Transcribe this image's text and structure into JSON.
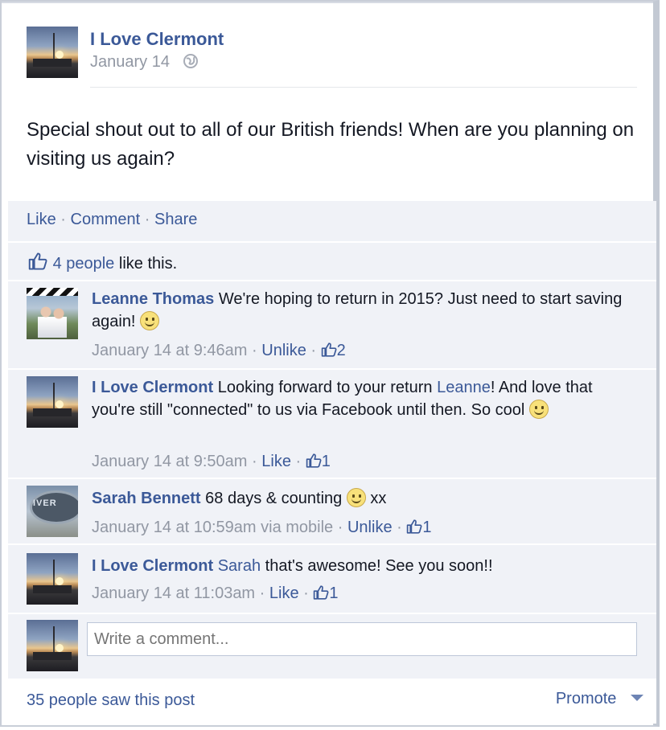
{
  "post": {
    "author": "I Love Clermont",
    "date": "January 14",
    "body": "Special shout out to all of our British friends! When are you planning on visiting us again?"
  },
  "actions": {
    "like": "Like",
    "comment": "Comment",
    "share": "Share",
    "sep": "·"
  },
  "likes": {
    "count_text": "4 people",
    "suffix": "like this."
  },
  "comments": [
    {
      "author": "Leanne Thomas",
      "text": "We're hoping to return in 2015? Just need to start saving again!",
      "timestamp": "January 14 at 9:46am",
      "action": "Unlike",
      "likes": "2"
    },
    {
      "author": "I Love Clermont",
      "text_before": "Looking forward to your return",
      "mention": "Leanne",
      "text_after": "! And love that you're still \"connected\" to us via Facebook until then. So cool",
      "timestamp": "January 14 at 9:50am",
      "action": "Like",
      "likes": "1"
    },
    {
      "author": "Sarah Bennett",
      "text": "68 days & counting",
      "text_after": "xx",
      "timestamp": "January 14 at 10:59am via mobile",
      "action": "Unlike",
      "likes": "1"
    },
    {
      "author": "I Love Clermont",
      "mention": "Sarah",
      "text_after": "that's awesome! See you soon!!",
      "timestamp": "January 14 at 11:03am",
      "action": "Like",
      "likes": "1"
    }
  ],
  "composer": {
    "placeholder": "Write a comment..."
  },
  "footer": {
    "seen": "35 people saw this post",
    "promote": "Promote"
  },
  "colors": {
    "link": "#3b5998",
    "meta": "#9197a3",
    "ufi_bg": "#f0f2f7"
  },
  "icons": [
    "globe-icon",
    "thumbs-up-icon",
    "smiley-icon",
    "chevron-down-icon"
  ]
}
